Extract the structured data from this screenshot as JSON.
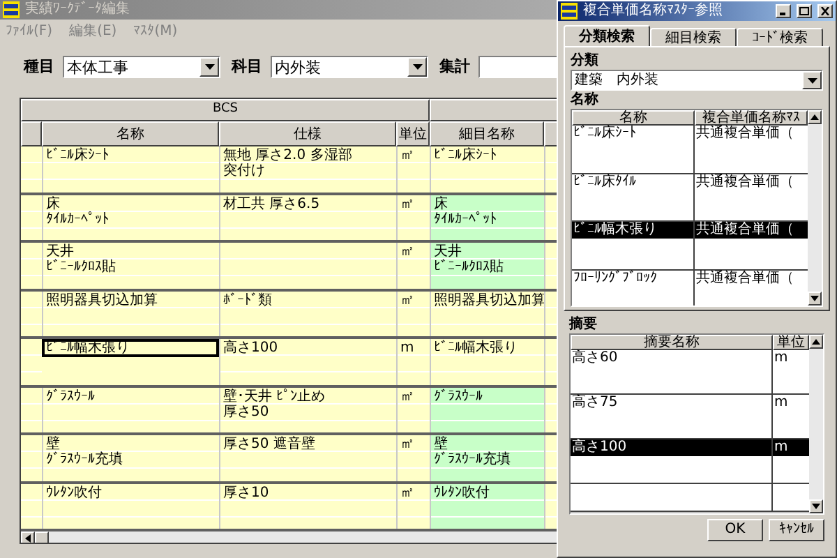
{
  "main_window": {
    "title": "実績ﾜｰｸﾃﾞｰﾀ編集",
    "menu": [
      "ﾌｧｲﾙ(F)",
      "編集(E)",
      "ﾏｽﾀ(M)"
    ],
    "filters": [
      {
        "label": "種目",
        "kind": "dropdown",
        "value": "本体工事"
      },
      {
        "label": "科目",
        "kind": "dropdown",
        "value": "内外装"
      },
      {
        "label": "集計",
        "kind": "text"
      }
    ],
    "table": {
      "group_header": "BCS",
      "columns": [
        "名称",
        "仕様",
        "単位",
        "細目名称"
      ],
      "rows": [
        {
          "name": [
            "ﾋﾞﾆﾙ床ｼｰﾄ"
          ],
          "spec": [
            "無地 厚さ2.0 多湿部",
            "突付け"
          ],
          "unit": "㎡",
          "detail_name": [
            "ﾋﾞﾆﾙ床ｼｰﾄ"
          ],
          "detail_highlighted": false,
          "selected": false
        },
        {
          "name": [
            "床",
            "ﾀｲﾙｶｰﾍﾟｯﾄ"
          ],
          "spec": [
            "材工共 厚さ6.5"
          ],
          "unit": "㎡",
          "detail_name": [
            "床",
            "ﾀｲﾙｶｰﾍﾟｯﾄ"
          ],
          "detail_highlighted": true,
          "selected": false
        },
        {
          "name": [
            "天井",
            "ﾋﾞﾆｰﾙｸﾛｽ貼"
          ],
          "spec": [],
          "unit": "㎡",
          "detail_name": [
            "天井",
            "ﾋﾞﾆｰﾙｸﾛｽ貼"
          ],
          "detail_highlighted": true,
          "selected": false
        },
        {
          "name": [
            "照明器具切込加算"
          ],
          "spec": [
            "ﾎﾞｰﾄﾞ類"
          ],
          "unit": "㎡",
          "detail_name": [
            "照明器具切込加算"
          ],
          "detail_highlighted": false,
          "selected": false
        },
        {
          "name": [
            "ﾋﾞﾆﾙ幅木張り"
          ],
          "spec": [
            "高さ100"
          ],
          "unit": "m",
          "detail_name": [
            "ﾋﾞﾆﾙ幅木張り"
          ],
          "detail_highlighted": false,
          "selected": true
        },
        {
          "name": [
            "ｸﾞﾗｽｳｰﾙ"
          ],
          "spec": [
            "壁･天井 ﾋﾟﾝ止め",
            "厚さ50"
          ],
          "unit": "㎡",
          "detail_name": [
            "ｸﾞﾗｽｳｰﾙ"
          ],
          "detail_highlighted": true,
          "selected": false
        },
        {
          "name": [
            "壁",
            "ｸﾞﾗｽｳｰﾙ充填"
          ],
          "spec": [
            "厚さ50 遮音壁"
          ],
          "unit": "㎡",
          "detail_name": [
            "壁",
            "ｸﾞﾗｽｳｰﾙ充填"
          ],
          "detail_highlighted": true,
          "selected": false
        },
        {
          "name": [
            "ｳﾚﾀﾝ吹付"
          ],
          "spec": [
            "厚さ10"
          ],
          "unit": "㎡",
          "detail_name": [
            "ｳﾚﾀﾝ吹付"
          ],
          "detail_highlighted": true,
          "selected": false
        }
      ]
    }
  },
  "dialog": {
    "title": "複合単価名称ﾏｽﾀｰ参照",
    "tabs": [
      {
        "label": "分類検索",
        "selected": true
      },
      {
        "label": "細目検索",
        "selected": false
      },
      {
        "label": "ｺｰﾄﾞ検索",
        "selected": false
      }
    ],
    "category_label": "分類",
    "category_value": "建築　内外装",
    "names_label": "名称",
    "names_columns": [
      "名称",
      "複合単価名称ﾏｽ"
    ],
    "names_rows": [
      {
        "name": "ﾋﾞﾆﾙ床ｼｰﾄ",
        "master": "共通複合単価（",
        "selected": false
      },
      {
        "name": "ﾋﾞﾆﾙ床ﾀｲﾙ",
        "master": "共通複合単価（",
        "selected": false
      },
      {
        "name": "ﾋﾞﾆﾙ幅木張り",
        "master": "共通複合単価（",
        "selected": true
      },
      {
        "name": "ﾌﾛｰﾘﾝｸﾞﾌﾞﾛｯｸ",
        "master": "共通複合単価（",
        "selected": false
      }
    ],
    "summary_label": "摘要",
    "summary_columns": [
      "摘要名称",
      "単位"
    ],
    "summary_rows": [
      {
        "name": "高さ60",
        "unit": "m",
        "selected": false
      },
      {
        "name": "高さ75",
        "unit": "m",
        "selected": false
      },
      {
        "name": "高さ100",
        "unit": "m",
        "selected": true
      }
    ],
    "buttons": [
      "OK",
      "ｷｬﾝｾﾙ"
    ]
  }
}
